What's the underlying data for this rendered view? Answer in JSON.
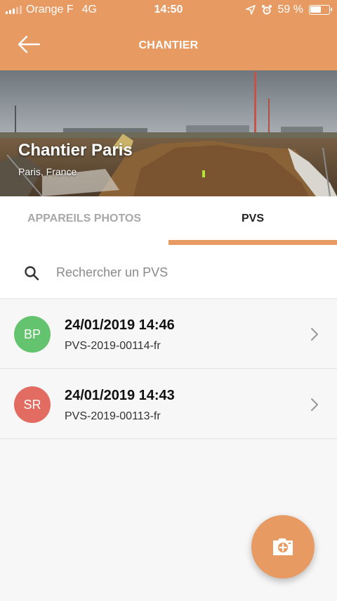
{
  "status_bar": {
    "carrier": "Orange F",
    "network": "4G",
    "time": "14:50",
    "battery": "59 %",
    "battery_level": 0.59
  },
  "header": {
    "title": "CHANTIER",
    "back_icon": "arrow-left-icon"
  },
  "hero": {
    "title": "Chantier Paris",
    "subtitle": "Paris, France"
  },
  "tabs": [
    {
      "label": "APPAREILS PHOTOS",
      "active": false
    },
    {
      "label": "PVS",
      "active": true
    }
  ],
  "search": {
    "placeholder": "Rechercher un PVS",
    "value": ""
  },
  "items": [
    {
      "initials": "BP",
      "avatar_color": "#63c36f",
      "title": "24/01/2019 14:46",
      "subtitle": "PVS-2019-00114-fr"
    },
    {
      "initials": "SR",
      "avatar_color": "#e26c62",
      "title": "24/01/2019 14:43",
      "subtitle": "PVS-2019-00113-fr"
    }
  ],
  "fab": {
    "icon": "add-photo-icon"
  },
  "colors": {
    "accent": "#e79a62"
  }
}
